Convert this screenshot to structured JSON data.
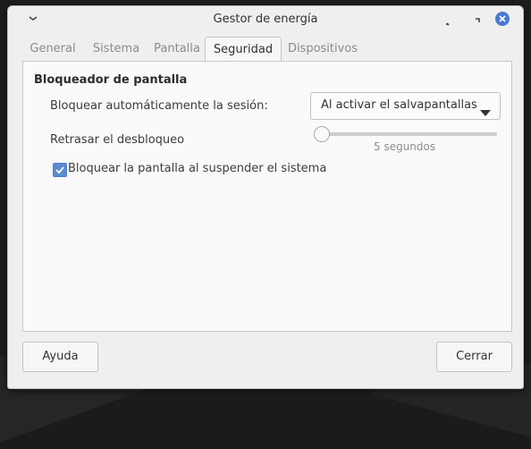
{
  "window": {
    "title": "Gestor de energía",
    "controls": {
      "menu_icon": "chevron-down-icon",
      "minimize_icon": "minimize-icon",
      "maximize_icon": "maximize-icon",
      "close_icon": "close-icon"
    }
  },
  "tabs": [
    {
      "label": "General",
      "active": false
    },
    {
      "label": "Sistema",
      "active": false
    },
    {
      "label": "Pantalla",
      "active": false
    },
    {
      "label": "Seguridad",
      "active": true
    },
    {
      "label": "Dispositivos",
      "active": false
    }
  ],
  "screen_locker": {
    "section_title": "Bloqueador de pantalla",
    "auto_lock_label": "Bloquear automáticamente la sesión:",
    "auto_lock_value": "Al activar el salvapantallas",
    "delay_label": "Retrasar el desbloqueo",
    "delay_value_text": "5 segundos",
    "delay_level": 0,
    "lock_on_suspend_label": "Bloquear la pantalla al suspender el sistema",
    "lock_on_suspend_checked": true
  },
  "buttons": {
    "help": "Ayuda",
    "close": "Cerrar"
  },
  "colors": {
    "accent": "#5a8ad0",
    "close_button": "#4a7ad0"
  }
}
